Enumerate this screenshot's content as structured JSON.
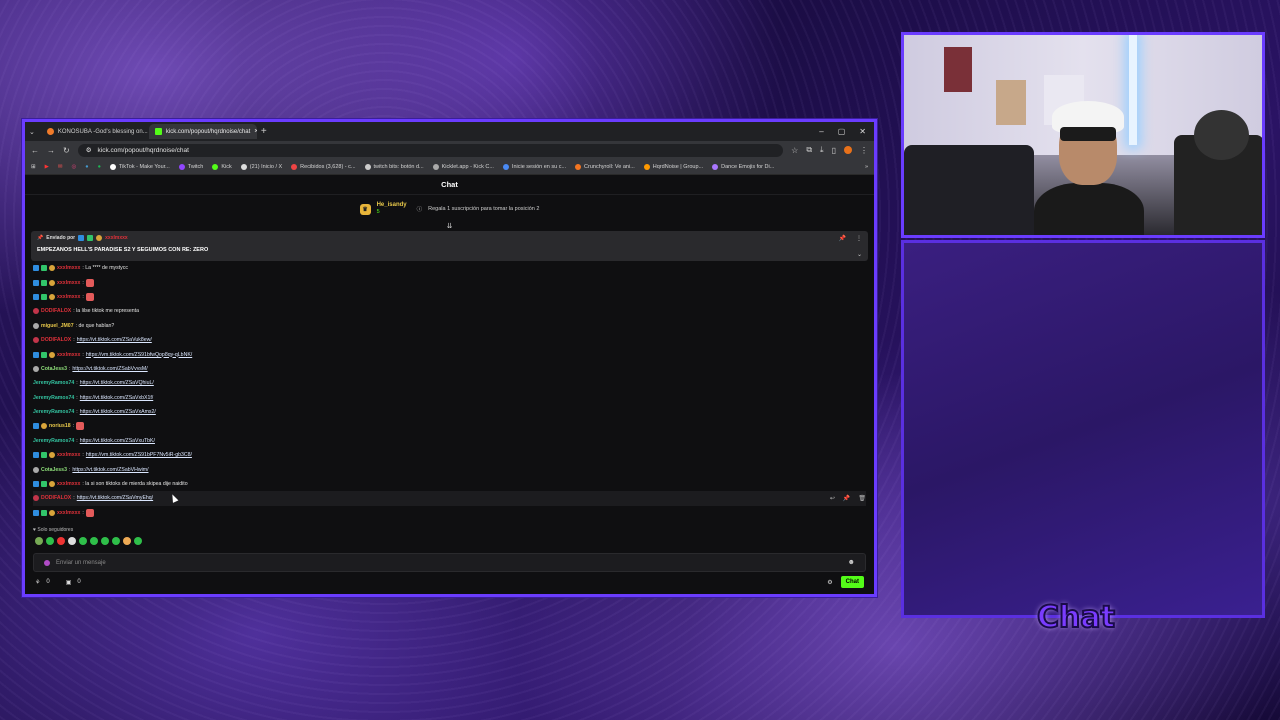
{
  "browser": {
    "tabs": [
      {
        "title": "KONOSUBA -God's blessing on..."
      },
      {
        "title": "kick.com/popout/hqrdnoise/chat"
      }
    ],
    "url": "kick.com/popout/hqrdnoise/chat",
    "bookmarks": [
      "TikTok - Make Your...",
      "Twitch",
      "Kick",
      "(21) Inicio / X",
      "Recibidos (3,628) - c...",
      "twitch bits: botón d...",
      "Kicklet.app - Kick C...",
      "Inicie sesión en su c...",
      "Crunchyroll: Ve ani...",
      "HqrdNoise | Group...",
      "Dance Emojis for Di..."
    ]
  },
  "chat": {
    "header": "Chat",
    "gift": {
      "user": "He_isandy",
      "amount": "5",
      "text": "Regala 1 suscripción para tomar la posición 2"
    },
    "pinned": {
      "by_label": "Enviado por",
      "by_user": "xxxlmxxx",
      "text": "EMPEZANOS HELL'S PARADISE S2 Y SEGUIMOS CON RE: ZERO"
    },
    "messages": [
      {
        "badges": [
          "bb",
          "bg-g",
          "by"
        ],
        "user": "xxxlmxxx",
        "color": "#e0313a",
        "text": ": La **** de mystycc",
        "link": ""
      },
      {
        "badges": [
          "bb",
          "bg-g",
          "by"
        ],
        "user": "xxxlmxxx",
        "color": "#e0313a",
        "text": ":",
        "link": "",
        "emote": true
      },
      {
        "badges": [
          "bb",
          "bg-g",
          "by"
        ],
        "user": "xxxlmxxx",
        "color": "#e0313a",
        "text": ":",
        "link": "",
        "emote": true
      },
      {
        "badges": [
          "bp"
        ],
        "user": "DODIFALOX",
        "color": "#e0313a",
        "text": ": la lilse tiktok me representa",
        "link": ""
      },
      {
        "badges": [
          "bw"
        ],
        "user": "miguel_JM07",
        "color": "#e8c84a",
        "text": ": de que hablan?",
        "link": ""
      },
      {
        "badges": [
          "bp"
        ],
        "user": "DODIFALOX",
        "color": "#e0313a",
        "text": ": ",
        "link": "https://vt.tiktok.com/ZSaVuk8ew/"
      },
      {
        "badges": [
          "bb",
          "bg-g",
          "by"
        ],
        "user": "xxxlmxxx",
        "color": "#e0313a",
        "text": ": ",
        "link": "https://vm.tiktok.com/ZS91bfwQop8qy-qLbNK/"
      },
      {
        "badges": [
          "bw"
        ],
        "user": "CotaJess3",
        "color": "#8fe07a",
        "text": ": ",
        "link": "https://vt.tiktok.com/ZSabVvvsM/"
      },
      {
        "badges": [],
        "user": "JeremyRamos74",
        "color": "#34c3a0",
        "text": ": ",
        "link": "https://vt.tiktok.com/ZSaVQhiuL/"
      },
      {
        "badges": [],
        "user": "JeremyRamos74",
        "color": "#34c3a0",
        "text": ": ",
        "link": "https://vt.tiktok.com/ZSaVxbX1f/"
      },
      {
        "badges": [],
        "user": "JeremyRamos74",
        "color": "#34c3a0",
        "text": ": ",
        "link": "https://vt.tiktok.com/ZSaVxAms2/"
      },
      {
        "badges": [
          "bb",
          "by"
        ],
        "user": "norius18",
        "color": "#e8c84a",
        "text": ":",
        "link": "",
        "emote": true
      },
      {
        "badges": [],
        "user": "JeremyRamos74",
        "color": "#34c3a0",
        "text": ": ",
        "link": "https://vt.tiktok.com/ZSaVxuTbK/"
      },
      {
        "badges": [
          "bb",
          "bg-g",
          "by"
        ],
        "user": "xxxlmxxx",
        "color": "#e0313a",
        "text": ": ",
        "link": "https://vm.tiktok.com/ZS91bPF7Nv5iR-gb3C8/"
      },
      {
        "badges": [
          "bw"
        ],
        "user": "CotaJess3",
        "color": "#8fe07a",
        "text": ": ",
        "link": "https://vt.tiktok.com/ZSabVHwim/"
      },
      {
        "badges": [
          "bb",
          "bg-g",
          "by"
        ],
        "user": "xxxlmxxx",
        "color": "#e0313a",
        "text": ": la si son tiktoks de mierda skipea dije naidito",
        "link": ""
      },
      {
        "badges": [
          "bp"
        ],
        "user": "DODIFALOX",
        "color": "#e0313a",
        "text": ": ",
        "link": "https://vt.tiktok.com/ZSaVmyEhq/"
      },
      {
        "badges": [
          "bb",
          "bg-g",
          "by"
        ],
        "user": "xxxlmxxx",
        "color": "#e0313a",
        "text": ":",
        "link": "",
        "emote": true
      }
    ],
    "followers_only": "Solo seguidores",
    "input_placeholder": "Enviar un mensaje",
    "viewer_count": "0",
    "points": "0",
    "send_label": "Chat"
  },
  "overlay": {
    "chat_label": "Chat"
  }
}
